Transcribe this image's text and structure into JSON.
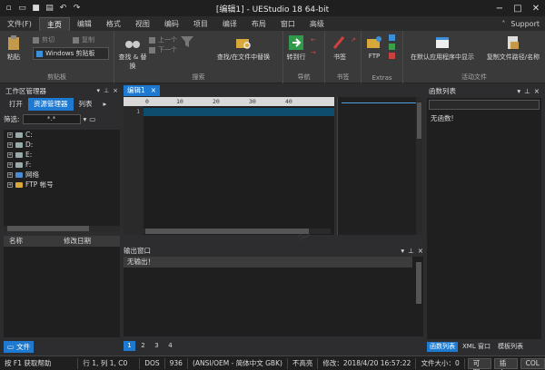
{
  "titlebar": {
    "title": "[编辑1] - UEStudio 18 64-bit",
    "quick_icons": [
      "new-file-icon",
      "open-file-icon",
      "save-icon",
      "print-icon",
      "undo-icon",
      "redo-icon"
    ],
    "controls": [
      "−",
      "□",
      "✕"
    ]
  },
  "menu": {
    "tabs": [
      "文件(F)",
      "主页",
      "编辑",
      "格式",
      "视图",
      "编码",
      "项目",
      "编译",
      "布局",
      "窗口",
      "高级"
    ],
    "active": "主页",
    "support": "Support"
  },
  "ribbon": {
    "clipboard": {
      "paste": "粘贴",
      "cut": "剪切",
      "copy": "复制",
      "clipboard_select": "Windows 剪贴板",
      "label": "剪贴板"
    },
    "search": {
      "find_replace": "查找 & 替换",
      "prev": "上一个",
      "next": "下一个",
      "find_in_files": "查找/在文件中替换",
      "label": "搜索"
    },
    "nav": {
      "goto": "转到行",
      "label": "导航"
    },
    "bookmarks": {
      "bookmark": "书签",
      "label": "书签"
    },
    "extras": {
      "ftp": "FTP",
      "label": "Extras"
    },
    "active_file": {
      "open_default": "在默认应用程序中显示",
      "copy_path": "复制文件路径/名称",
      "label": "活动文件"
    }
  },
  "left_panel": {
    "title": "工作区管理器",
    "tabs": [
      "打开",
      "资源管理器",
      "列表"
    ],
    "filter_label": "筛选:",
    "filter_value": "*.*",
    "tree": [
      "C:",
      "D:",
      "E:",
      "F:",
      "网络",
      "FTP 帐号"
    ],
    "columns": [
      "名称",
      "修改日期"
    ],
    "footer_tab": "文件"
  },
  "editor": {
    "tab_label": "编辑1",
    "ruler_marks": [
      "0",
      "10",
      "20",
      "30",
      "40"
    ],
    "line_number": "1"
  },
  "output": {
    "title": "输出窗口",
    "text": "无输出！",
    "pages": [
      "1",
      "2",
      "3",
      "4"
    ]
  },
  "right_panel": {
    "title": "函数列表",
    "empty": "无函数!",
    "tabs": [
      "函数列表",
      "XML 窗口",
      "模板列表"
    ]
  },
  "status": {
    "help": "按 F1 获取帮助",
    "position": "行 1, 列 1, C0",
    "eol": "DOS",
    "codepage": "936",
    "encoding": "(ANSI/OEM - 简体中文 GBK)",
    "highlight": "不高亮",
    "modified": "修改：2018/4/20 16:57:22",
    "size": "文件大小：0",
    "rw": "可写",
    "ins": "插入",
    "col": "COL"
  }
}
